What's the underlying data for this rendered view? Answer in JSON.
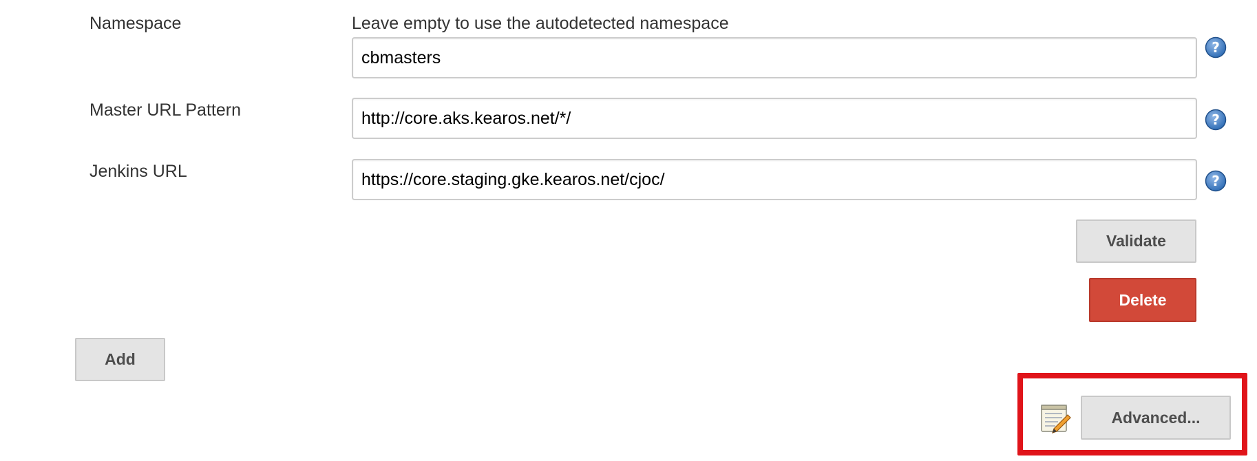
{
  "namespace": {
    "label": "Namespace",
    "hint": "Leave empty to use the autodetected namespace",
    "value": "cbmasters"
  },
  "master_url_pattern": {
    "label": "Master URL Pattern",
    "value": "http://core.aks.kearos.net/*/"
  },
  "jenkins_url": {
    "label": "Jenkins URL",
    "value": "https://core.staging.gke.kearos.net/cjoc/"
  },
  "buttons": {
    "validate": "Validate",
    "delete": "Delete",
    "add": "Add",
    "advanced": "Advanced..."
  },
  "icons": {
    "help": "help-icon",
    "notepad": "notepad-icon"
  },
  "colors": {
    "help_blue": "#2b6ab3",
    "delete_red": "#d24939",
    "highlight_red": "#e0141a"
  }
}
